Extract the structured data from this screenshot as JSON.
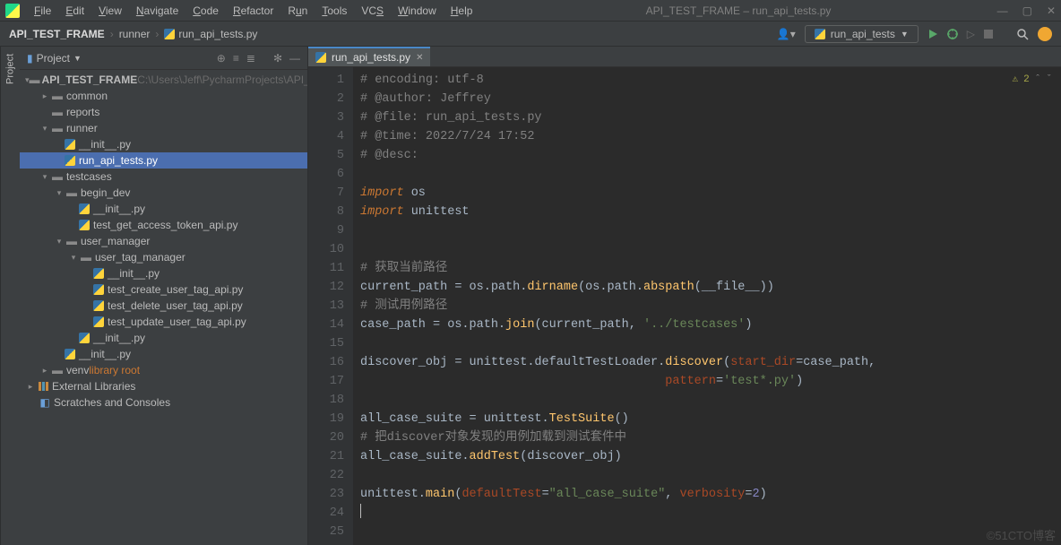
{
  "window": {
    "title": "API_TEST_FRAME – run_api_tests.py"
  },
  "menu": {
    "file": "File",
    "edit": "Edit",
    "view": "View",
    "navigate": "Navigate",
    "code": "Code",
    "refactor": "Refactor",
    "run": "Run",
    "tools": "Tools",
    "vcs": "VCS",
    "window": "Window",
    "help": "Help"
  },
  "breadcrumbs": {
    "root": "API_TEST_FRAME",
    "folder": "runner",
    "file": "run_api_tests.py"
  },
  "run_config": {
    "label": "run_api_tests"
  },
  "side_tab": {
    "project": "Project"
  },
  "panel": {
    "title": "Project"
  },
  "tree": {
    "root": "API_TEST_FRAME",
    "root_path": " C:\\Users\\Jeff\\PycharmProjects\\API_",
    "common": "common",
    "reports": "reports",
    "runner": "runner",
    "init": "__init__.py",
    "run_api_tests": "run_api_tests.py",
    "testcases": "testcases",
    "begin_dev": "begin_dev",
    "test_get_access_token": "test_get_access_token_api.py",
    "user_manager": "user_manager",
    "user_tag_manager": "user_tag_manager",
    "test_create_user_tag": "test_create_user_tag_api.py",
    "test_delete_user_tag": "test_delete_user_tag_api.py",
    "test_update_user_tag": "test_update_user_tag_api.py",
    "venv": "venv",
    "venv_hint": " library root",
    "ext_libs": "External Libraries",
    "scratches": "Scratches and Consoles"
  },
  "tab": {
    "file": "run_api_tests.py"
  },
  "status": {
    "problems": "2"
  },
  "code": {
    "l1": "# encoding: utf-8",
    "l2": "# @author: Jeffrey",
    "l3": "# @file: run_api_tests.py",
    "l4": "# @time: 2022/7/24 17:52",
    "l5": "# @desc:",
    "l7_import": "import",
    "l7_os": " os",
    "l8_import": "import",
    "l8_ut": " unittest",
    "l11": "# 获取当前路径",
    "l12_a": "current_path = os.path.",
    "l12_dirname": "dirname",
    "l12_b": "(os.path.",
    "l12_abspath": "abspath",
    "l12_c": "(__file__))",
    "l13": "# 测试用例路径",
    "l14_a": "case_path = os.path.",
    "l14_join": "join",
    "l14_b": "(current_path, ",
    "l14_str": "'../testcases'",
    "l14_c": ")",
    "l16_a": "discover_obj = unittest.defaultTestLoader.",
    "l16_disc": "discover",
    "l16_b": "(",
    "l16_p1": "start_dir",
    "l16_c": "=case_path,",
    "l17_pad": "                                          ",
    "l17_p": "pattern",
    "l17_eq": "=",
    "l17_str": "'test*.py'",
    "l17_c": ")",
    "l19_a": "all_case_suite = unittest.",
    "l19_ts": "TestSuite",
    "l19_b": "()",
    "l20": "# 把discover对象发现的用例加载到测试套件中",
    "l21_a": "all_case_suite.",
    "l21_add": "addTest",
    "l21_b": "(discover_obj)",
    "l23_a": "unittest.",
    "l23_main": "main",
    "l23_b": "(",
    "l23_p1": "defaultTest",
    "l23_eq": "=",
    "l23_str": "\"all_case_suite\"",
    "l23_c": ", ",
    "l23_p2": "verbosity",
    "l23_d": "=",
    "l23_num": "2",
    "l23_e": ")"
  },
  "watermark": "©51CTO博客"
}
